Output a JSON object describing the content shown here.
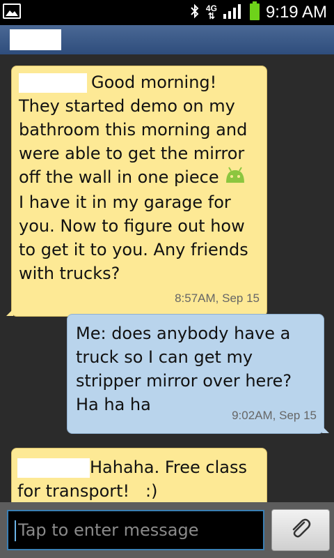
{
  "status_bar": {
    "time": "9:19 AM",
    "network": "4G",
    "icons": [
      "gallery-icon",
      "bluetooth-icon",
      "network-4g-icon",
      "signal-icon",
      "battery-icon"
    ],
    "battery_color": "#6ed21a"
  },
  "header": {
    "contact_name": ""
  },
  "messages": [
    {
      "direction": "incoming",
      "sender_redacted": true,
      "line1": "Good morning!",
      "body_before_emoji": "They started demo on my\nbathroom this morning and\nwere able to get the mirror\noff the wall in one piece",
      "emoji": "android-icon",
      "body_after_emoji": "I have it in my garage for\nyou. Now to figure out how\nto get it to you. Any friends\nwith trucks?",
      "timestamp": "8:57AM, Sep 15"
    },
    {
      "direction": "outgoing",
      "text": "Me: does anybody have a\ntruck so I can get my\nstripper mirror over here?\nHa ha ha",
      "timestamp": "9:02AM, Sep 15"
    },
    {
      "direction": "incoming",
      "sender_redacted": true,
      "line1": "Hahaha.  Free class",
      "body": "for transport!   :)"
    }
  ],
  "compose": {
    "placeholder": "Tap to enter message",
    "attach_icon": "paperclip-icon"
  },
  "colors": {
    "incoming_bubble": "#fde995",
    "outgoing_bubble": "#b9d4ec",
    "header": "#3b5a88",
    "background": "#2b2b2b",
    "emoji": "#8cc63f"
  }
}
